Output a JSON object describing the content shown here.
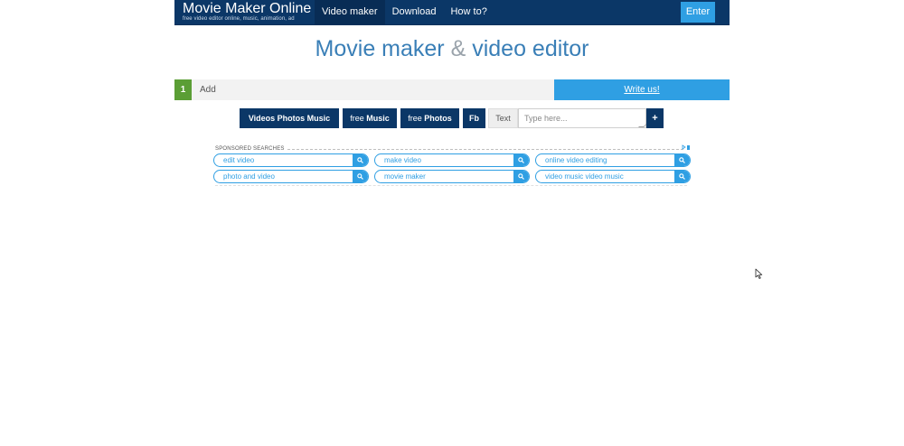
{
  "navbar": {
    "brand_name": "Movie Maker Online",
    "brand_tagline": "free video editor online, music, animation, ad",
    "items": [
      {
        "label": "Video maker",
        "active": true
      },
      {
        "label": "Download",
        "active": false
      },
      {
        "label": "How to?",
        "active": false
      }
    ],
    "enter_label": "Enter"
  },
  "title": {
    "part1": "Movie maker",
    "amp": "&",
    "part2": "video editor"
  },
  "add_row": {
    "step_number": "1",
    "add_label": "Add",
    "write_us_label": "Write us!"
  },
  "toolbar": {
    "videos_photos_music": "Videos Photos Music",
    "free_music_prefix": "free",
    "free_music_bold": "Music",
    "free_photos_prefix": "free",
    "free_photos_bold": "Photos",
    "fb_label": "Fb",
    "text_label": "Text",
    "text_placeholder": "Type here...",
    "add_text_label": "+"
  },
  "sponsored": {
    "heading": "SPONSORED SEARCHES",
    "items": [
      "edit video",
      "make video",
      "online video editing",
      "photo and video",
      "movie maker",
      "video music video music"
    ],
    "search_icon": "search-icon",
    "adchoices_icon": "adchoices-icon"
  },
  "colors": {
    "navbar": "#0b3767",
    "accent": "#2f9fe3",
    "title": "#3a7fb7",
    "step_green": "#5b9e35"
  }
}
